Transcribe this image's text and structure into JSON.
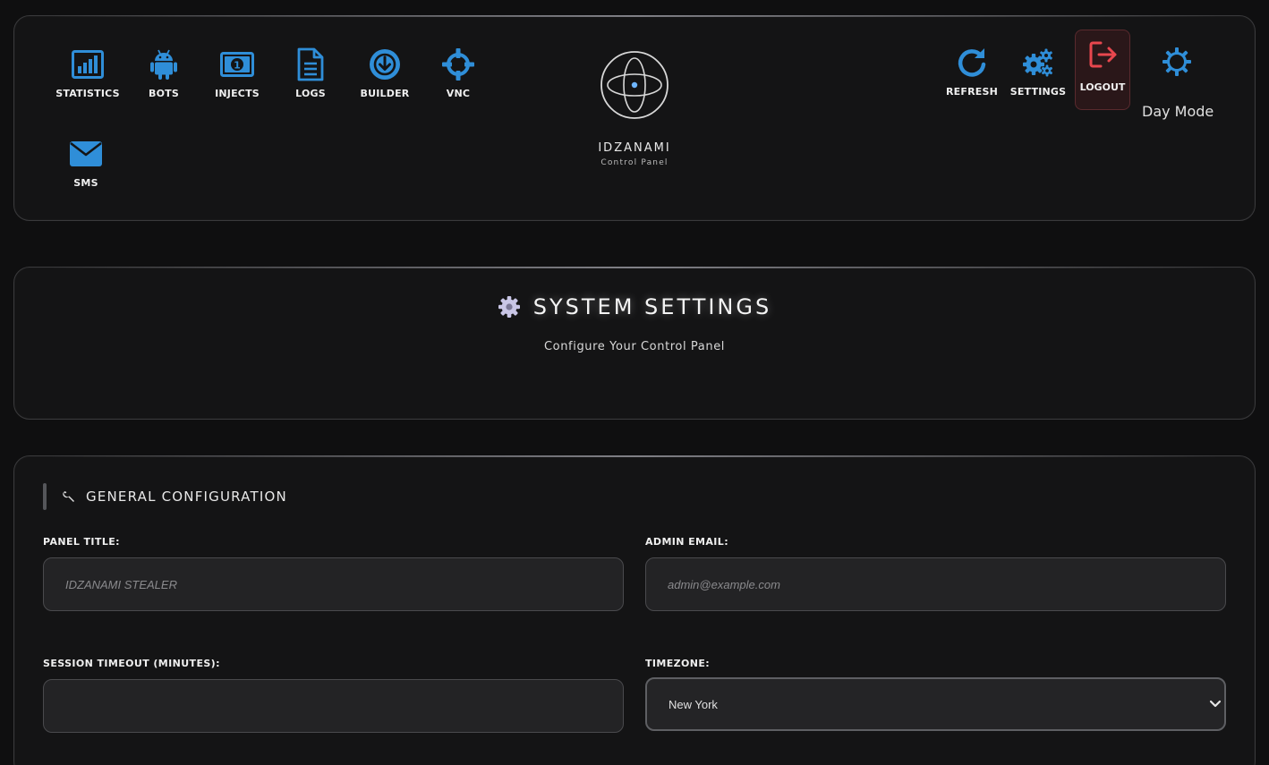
{
  "nav": {
    "statistics": "STATISTICS",
    "bots": "BOTS",
    "injects": "INJECTS",
    "logs": "LOGS",
    "builder": "BUILDER",
    "vnc": "VNC",
    "sms": "SMS"
  },
  "brand": {
    "name": "IDZANAMI",
    "subtitle": "Control Panel"
  },
  "actions": {
    "refresh": "REFRESH",
    "settings": "SETTINGS",
    "logout": "LOGOUT",
    "day_mode": "Day Mode"
  },
  "page": {
    "title": "SYSTEM SETTINGS",
    "subtitle": "Configure Your Control Panel"
  },
  "general": {
    "title": "GENERAL CONFIGURATION",
    "panel_title_label": "PANEL TITLE:",
    "panel_title_placeholder": "IDZANAMI STEALER",
    "admin_email_label": "ADMIN EMAIL:",
    "admin_email_placeholder": "admin@example.com",
    "session_timeout_label": "SESSION TIMEOUT (MINUTES):",
    "session_timeout_value": "",
    "timezone_label": "TIMEZONE:",
    "timezone_selected": "New York"
  },
  "colors": {
    "accent": "#2f8ed8",
    "logout": "#e8474e",
    "background": "#0f0f10",
    "panel": "#141415"
  },
  "icons": [
    "bar-chart-icon",
    "android-icon",
    "banknote-icon",
    "document-icon",
    "download-circle-icon",
    "crosshair-icon",
    "envelope-icon",
    "refresh-icon",
    "gears-icon",
    "logout-icon",
    "sun-icon",
    "orbit-logo",
    "gear-icon",
    "wrench-icon",
    "chevron-down-icon"
  ]
}
